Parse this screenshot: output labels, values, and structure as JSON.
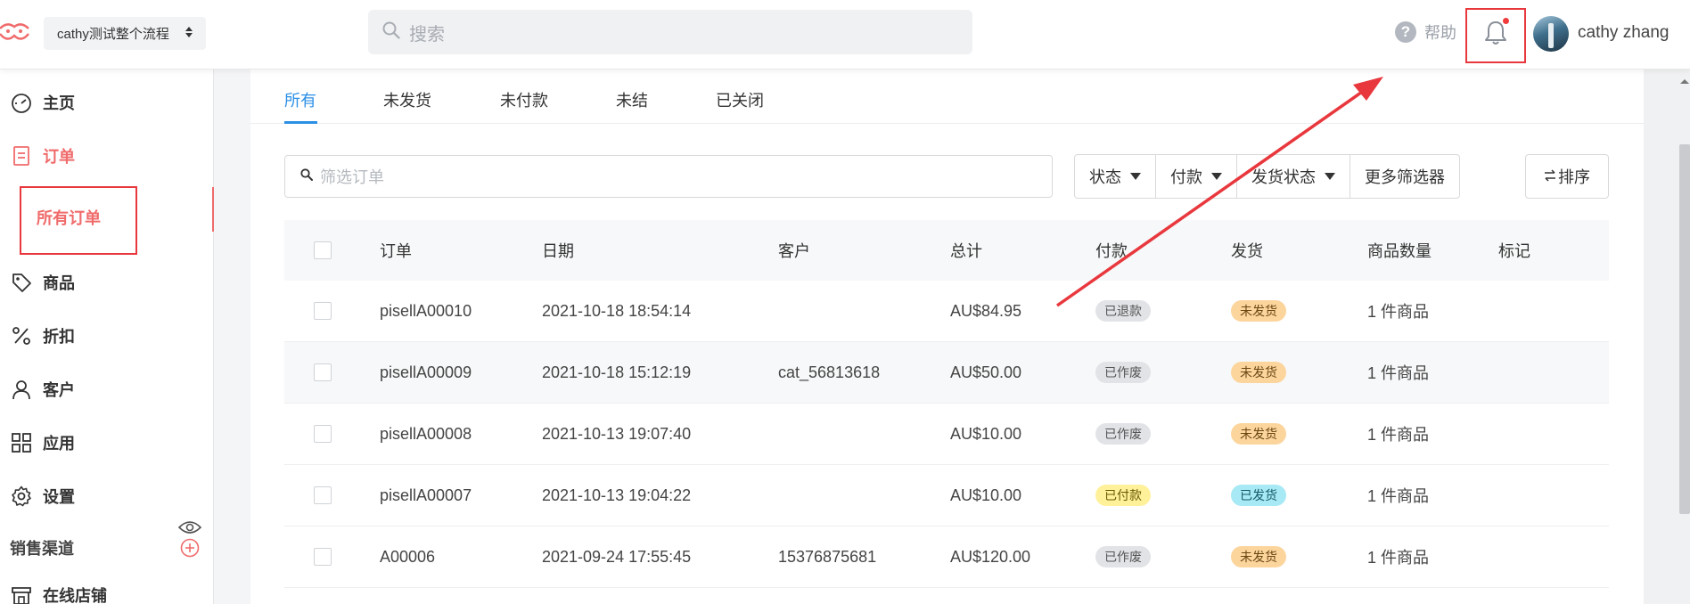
{
  "header": {
    "store_name": "cathy测试整个流程",
    "search_placeholder": "搜索",
    "help_label": "帮助",
    "user_name": "cathy zhang"
  },
  "sidebar": {
    "items": [
      {
        "label": "主页",
        "icon": "dashboard-icon"
      },
      {
        "label": "订单",
        "icon": "order-icon",
        "active": true
      },
      {
        "label": "商品",
        "icon": "tag-icon"
      },
      {
        "label": "折扣",
        "icon": "percent-icon"
      },
      {
        "label": "客户",
        "icon": "user-icon"
      },
      {
        "label": "应用",
        "icon": "apps-icon"
      },
      {
        "label": "设置",
        "icon": "gear-icon"
      }
    ],
    "sub_item": "所有订单",
    "section_title": "销售渠道",
    "channel": "在线店铺"
  },
  "tabs": [
    "所有",
    "未发货",
    "未付款",
    "未结",
    "已关闭"
  ],
  "filters": {
    "placeholder": "筛选订单",
    "status": "状态",
    "payment": "付款",
    "shipping_status": "发货状态",
    "more": "更多筛选器",
    "sort": "排序"
  },
  "table": {
    "headers": [
      "订单",
      "日期",
      "客户",
      "总计",
      "付款",
      "发货",
      "商品数量",
      "标记"
    ],
    "rows": [
      {
        "order": "pisellA00010",
        "date": "2021-10-18 18:54:14",
        "customer": "",
        "total": "AU$84.95",
        "payment": "已退款",
        "shipping": "未发货",
        "qty": "1 件商品"
      },
      {
        "order": "pisellA00009",
        "date": "2021-10-18 15:12:19",
        "customer": "cat_56813618",
        "total": "AU$50.00",
        "payment": "已作废",
        "shipping": "未发货",
        "qty": "1 件商品"
      },
      {
        "order": "pisellA00008",
        "date": "2021-10-13 19:07:40",
        "customer": "",
        "total": "AU$10.00",
        "payment": "已作废",
        "shipping": "未发货",
        "qty": "1 件商品"
      },
      {
        "order": "pisellA00007",
        "date": "2021-10-13 19:04:22",
        "customer": "",
        "total": "AU$10.00",
        "payment": "已付款",
        "shipping": "已发货",
        "qty": "1 件商品"
      },
      {
        "order": "A00006",
        "date": "2021-09-24 17:55:45",
        "customer": "15376875681",
        "total": "AU$120.00",
        "payment": "已作废",
        "shipping": "未发货",
        "qty": "1 件商品"
      }
    ]
  },
  "colors": {
    "accent_blue": "#2b8fe6",
    "active_red": "#f06b6b",
    "annotation_red": "#e8383d"
  }
}
